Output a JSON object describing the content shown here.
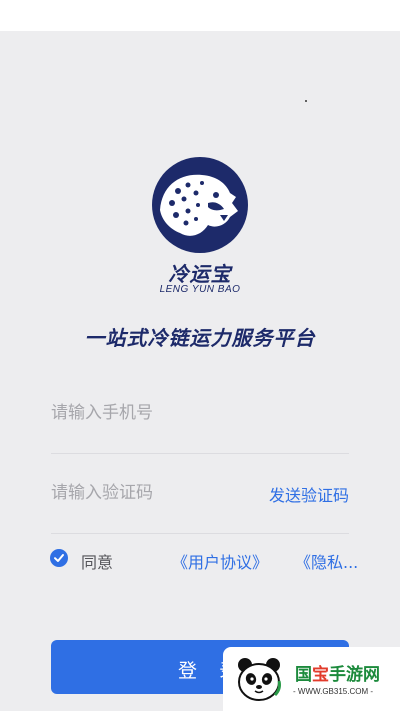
{
  "brand": {
    "name": "冷运宝",
    "name_en": "LENG YUN BAO",
    "slogan": "一站式冷链运力服务平台",
    "logo_icon": "leopard-logo-icon",
    "primary_color": "#1d2a6a"
  },
  "form": {
    "phone_placeholder": "请输入手机号",
    "code_placeholder": "请输入验证码",
    "send_code_label": "发送验证码"
  },
  "agreement": {
    "checked": true,
    "prefix": "同意",
    "user_agreement": "《用户协议》",
    "privacy_policy": "《隐私..."
  },
  "login": {
    "label": "登 录",
    "accent_color": "#2f6fe4"
  },
  "watermark": {
    "icon": "panda-icon",
    "title_part1": "国",
    "title_part2": "宝",
    "title_part3": "手游网",
    "url": "- WWW.GB315.COM -"
  }
}
